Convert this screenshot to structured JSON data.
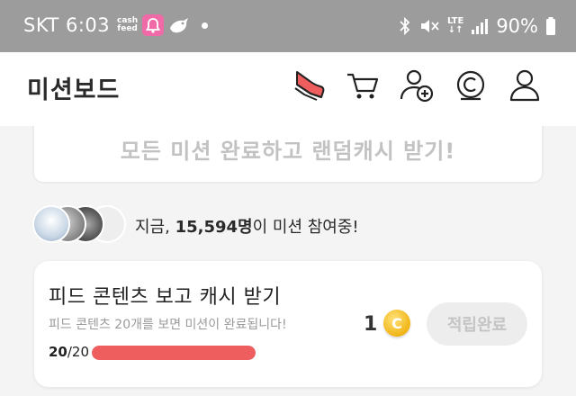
{
  "status_bar": {
    "carrier": "SKT",
    "time": "6:03",
    "cashfeed_line1": "cash",
    "cashfeed_line2": "feed",
    "network_top": "LTE",
    "network_bottom": "↓↑",
    "battery": "90%"
  },
  "header": {
    "title": "미션보드",
    "icons": [
      "sneaker-icon",
      "cart-icon",
      "add-friend-icon",
      "cash-coin-icon",
      "profile-icon"
    ]
  },
  "banner": {
    "text": "모든 미션 완료하고 랜덤캐시 받기!"
  },
  "participants": {
    "prefix": "지금,",
    "count": "15,594명",
    "suffix": "이 미션 참여중!"
  },
  "mission": {
    "title": "피드 콘텐츠 보고 캐시 받기",
    "description": "피드 콘텐츠 20개를 보면 미션이 완료됩니다!",
    "progress_current": "20",
    "progress_total": "/20",
    "progress_fraction": 1.0,
    "reward": "1",
    "coin_symbol": "C",
    "claim_label": "적립완료"
  },
  "colors": {
    "status_bar": "#9c9c9c",
    "progress_fill": "#ee5e5e",
    "coin": "#f1b516",
    "sneaker_accent": "#ee5e5e"
  }
}
